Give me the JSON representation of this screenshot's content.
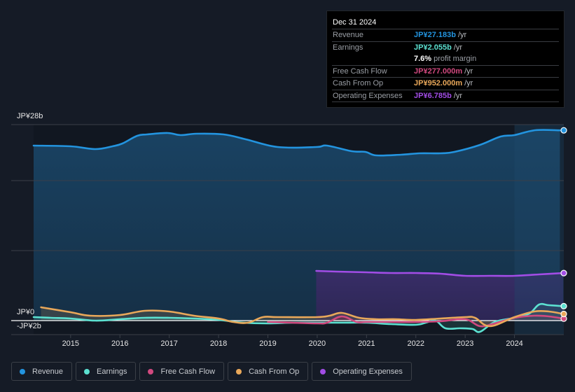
{
  "tooltip": {
    "date": "Dec 31 2024",
    "rows": [
      {
        "label": "Revenue",
        "value": "JP¥27.183b",
        "unit": "/yr",
        "color": "#2394df"
      },
      {
        "label": "Earnings",
        "value": "JP¥2.055b",
        "unit": "/yr",
        "color": "#5ce1d1"
      },
      {
        "label": "",
        "value": "7.6%",
        "unit": "profit margin",
        "color": "#ffffff"
      },
      {
        "label": "Free Cash Flow",
        "value": "JP¥277.000m",
        "unit": "/yr",
        "color": "#d1497f"
      },
      {
        "label": "Cash From Op",
        "value": "JP¥952.000m",
        "unit": "/yr",
        "color": "#e9a85a"
      },
      {
        "label": "Operating Expenses",
        "value": "JP¥6.785b",
        "unit": "/yr",
        "color": "#a24de6"
      }
    ]
  },
  "legend": [
    {
      "label": "Revenue",
      "color": "#2394df"
    },
    {
      "label": "Earnings",
      "color": "#5ce1d1"
    },
    {
      "label": "Free Cash Flow",
      "color": "#d1497f"
    },
    {
      "label": "Cash From Op",
      "color": "#e9a85a"
    },
    {
      "label": "Operating Expenses",
      "color": "#a24de6"
    }
  ],
  "chart_data": {
    "type": "area",
    "title": "",
    "xlabel": "",
    "ylabel": "",
    "y_unit": "JP¥ billions",
    "ylim": [
      -2,
      28
    ],
    "xlim": [
      2014.25,
      2025.0
    ],
    "y_tick_labels": [
      {
        "value": 28,
        "label": "JP¥28b"
      },
      {
        "value": 0,
        "label": "JP¥0"
      },
      {
        "value": -2,
        "label": "-JP¥2b"
      }
    ],
    "gridlines": [
      28,
      20,
      10,
      0,
      -2
    ],
    "x_ticks": [
      2015,
      2016,
      2017,
      2018,
      2019,
      2020,
      2021,
      2022,
      2023,
      2024
    ],
    "forecast_start": 2024.0,
    "series": [
      {
        "name": "Revenue",
        "color": "#2394df",
        "x": [
          2014.25,
          2015.0,
          2015.5,
          2015.85,
          2016.05,
          2016.35,
          2016.55,
          2016.97,
          2017.23,
          2017.55,
          2018.1,
          2018.55,
          2019.2,
          2019.98,
          2020.2,
          2020.7,
          2020.98,
          2021.2,
          2021.7,
          2022.08,
          2022.5,
          2022.78,
          2023.3,
          2023.72,
          2024.0,
          2024.42,
          2024.92
        ],
        "y": [
          25.0,
          24.9,
          24.5,
          24.9,
          25.3,
          26.4,
          26.6,
          26.8,
          26.5,
          26.7,
          26.6,
          25.9,
          24.8,
          24.8,
          25.0,
          24.2,
          24.1,
          23.6,
          23.7,
          23.9,
          23.9,
          24.1,
          25.1,
          26.3,
          26.5,
          27.2,
          27.18
        ]
      },
      {
        "name": "Earnings",
        "color": "#5ce1d1",
        "x": [
          2014.25,
          2014.6,
          2015.0,
          2015.5,
          2016.0,
          2016.5,
          2017.0,
          2017.5,
          2018.0,
          2018.5,
          2019.0,
          2019.5,
          2020.0,
          2020.5,
          2021.0,
          2021.5,
          2022.0,
          2022.2,
          2022.4,
          2022.6,
          2022.9,
          2023.15,
          2023.3,
          2023.6,
          2024.0,
          2024.3,
          2024.5,
          2024.7,
          2024.99
        ],
        "y": [
          0.5,
          0.4,
          0.3,
          0.0,
          0.2,
          0.4,
          0.4,
          0.3,
          0.1,
          -0.3,
          -0.4,
          -0.3,
          -0.3,
          -0.3,
          -0.3,
          -0.5,
          -0.6,
          -0.3,
          0.0,
          -1.1,
          -1.1,
          -1.2,
          -1.6,
          -0.2,
          0.4,
          1.0,
          2.3,
          2.2,
          2.06
        ]
      },
      {
        "name": "Free Cash Flow",
        "color": "#d1497f",
        "x": [
          2019.0,
          2019.5,
          2020.0,
          2020.2,
          2020.5,
          2020.8,
          2021.0,
          2021.5,
          2022.0,
          2022.5,
          2023.0,
          2023.3,
          2023.6,
          2024.0,
          2024.4,
          2024.7,
          2024.99
        ],
        "y": [
          -0.2,
          -0.3,
          -0.4,
          -0.3,
          0.6,
          -0.2,
          -0.2,
          -0.2,
          -0.2,
          -0.1,
          0.2,
          -0.8,
          -0.4,
          0.4,
          0.7,
          0.6,
          0.28
        ]
      },
      {
        "name": "Cash From Op",
        "color": "#e9a85a",
        "x": [
          2014.4,
          2015.0,
          2015.4,
          2016.0,
          2016.5,
          2017.0,
          2017.5,
          2018.0,
          2018.3,
          2018.6,
          2018.9,
          2019.2,
          2020.0,
          2020.25,
          2020.5,
          2020.85,
          2021.2,
          2021.6,
          2022.0,
          2022.5,
          2023.0,
          2023.2,
          2023.5,
          2024.0,
          2024.4,
          2024.7,
          2024.99
        ],
        "y": [
          1.9,
          1.2,
          0.7,
          0.8,
          1.4,
          1.3,
          0.7,
          0.3,
          -0.2,
          -0.3,
          0.5,
          0.5,
          0.5,
          0.7,
          1.1,
          0.4,
          0.2,
          0.2,
          0.1,
          0.3,
          0.5,
          0.4,
          -0.8,
          0.5,
          1.3,
          1.3,
          0.95
        ]
      },
      {
        "name": "Operating Expenses",
        "color": "#a24de6",
        "x": [
          2019.98,
          2020.4,
          2021.0,
          2021.5,
          2022.0,
          2022.5,
          2023.0,
          2023.5,
          2024.0,
          2024.5,
          2024.99
        ],
        "y": [
          7.1,
          7.0,
          6.9,
          6.8,
          6.8,
          6.7,
          6.4,
          6.4,
          6.4,
          6.6,
          6.79
        ]
      }
    ]
  }
}
